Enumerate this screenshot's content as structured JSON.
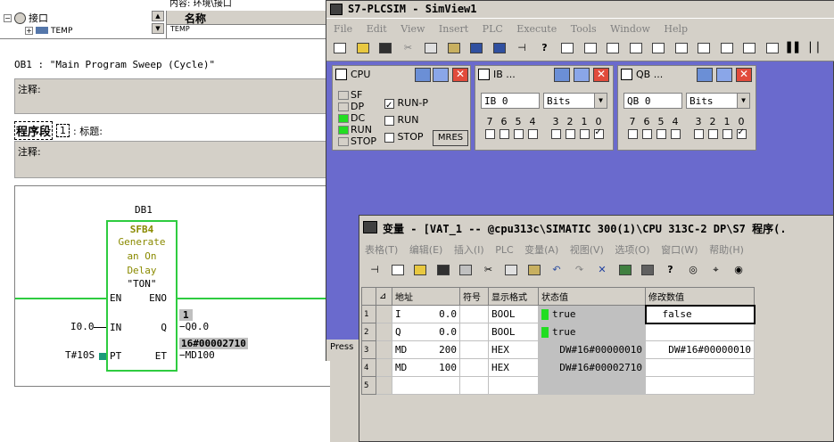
{
  "editor": {
    "tree_header_partial": "内容:  环境\\接口",
    "tree_root": "接口",
    "tree_child": "TEMP",
    "list_col_name": "名称",
    "list_row": "TEMP",
    "ob_title": "OB1 :  \"Main Program Sweep (Cycle)\"",
    "comment_label": "注释:",
    "network_label": "程序段",
    "network_number": "1",
    "network_title_label": ": 标题:",
    "network_comment_label": "注释:",
    "db_name": "DB1",
    "block_name": "SFB4",
    "block_desc": "Generate an On Delay",
    "block_type": "\"TON\"",
    "pin_en": "EN",
    "pin_eno": "ENO",
    "pin_in": "IN",
    "pin_q": "Q",
    "pin_pt": "PT",
    "pin_et": "ET",
    "in_operand": "I0.0",
    "pt_operand": "T#10S",
    "q_operand": "Q0.0",
    "et_operand": "MD100",
    "q_value": "1",
    "et_value": "16#00002710"
  },
  "plcsim": {
    "title": "S7-PLCSIM - SimView1",
    "menu": [
      "File",
      "Edit",
      "View",
      "Insert",
      "PLC",
      "Execute",
      "Tools",
      "Window",
      "Help"
    ],
    "status_partial": "Press",
    "cpu": {
      "title": "CPU",
      "leds": [
        "SF",
        "DP",
        "DC",
        "RUN",
        "STOP"
      ],
      "led_states": [
        "off",
        "off",
        "on",
        "on",
        "off"
      ],
      "modes": [
        "RUN-P",
        "RUN",
        "STOP"
      ],
      "mode_checked": [
        true,
        false,
        false
      ],
      "mres": "MRES"
    },
    "ib": {
      "title": "IB ...",
      "address": "IB  0",
      "format": "Bits",
      "bits": [
        "7",
        "6",
        "5",
        "4",
        "3",
        "2",
        "1",
        "0"
      ],
      "bit_states": [
        false,
        false,
        false,
        false,
        false,
        false,
        false,
        true
      ]
    },
    "qb": {
      "title": "QB ...",
      "address": "QB  0",
      "format": "Bits",
      "bits": [
        "7",
        "6",
        "5",
        "4",
        "3",
        "2",
        "1",
        "0"
      ],
      "bit_states": [
        false,
        false,
        false,
        false,
        false,
        false,
        false,
        true
      ]
    }
  },
  "vat": {
    "title": "变量 - [VAT_1 -- @cpu313c\\SIMATIC 300(1)\\CPU 313C-2 DP\\S7 程序(.",
    "menu": [
      "表格(T)",
      "编辑(E)",
      "插入(I)",
      "PLC",
      "变量(A)",
      "视图(V)",
      "选项(O)",
      "窗口(W)",
      "帮助(H)"
    ],
    "headers": [
      "地址",
      "符号",
      "显示格式",
      "状态值",
      "修改数值"
    ],
    "rows": [
      {
        "num": "1",
        "addr": "I",
        "offset": "0.0",
        "symbol": "",
        "format": "BOOL",
        "status": "true",
        "status_led": true,
        "modify": "false"
      },
      {
        "num": "2",
        "addr": "Q",
        "offset": "0.0",
        "symbol": "",
        "format": "BOOL",
        "status": "true",
        "status_led": true,
        "modify": ""
      },
      {
        "num": "3",
        "addr": "MD",
        "offset": "200",
        "symbol": "",
        "format": "HEX",
        "status": "DW#16#00000010",
        "status_led": false,
        "modify": "DW#16#00000010"
      },
      {
        "num": "4",
        "addr": "MD",
        "offset": "100",
        "symbol": "",
        "format": "HEX",
        "status": "DW#16#00002710",
        "status_led": false,
        "modify": ""
      },
      {
        "num": "5",
        "addr": "",
        "offset": "",
        "symbol": "",
        "format": "",
        "status": "",
        "status_led": false,
        "modify": ""
      }
    ]
  },
  "colors": {
    "ladder_green": "#2ecc40",
    "desktop_blue": "#6a6acd",
    "led_green": "#22dd22",
    "close_red": "#e14b3b"
  }
}
